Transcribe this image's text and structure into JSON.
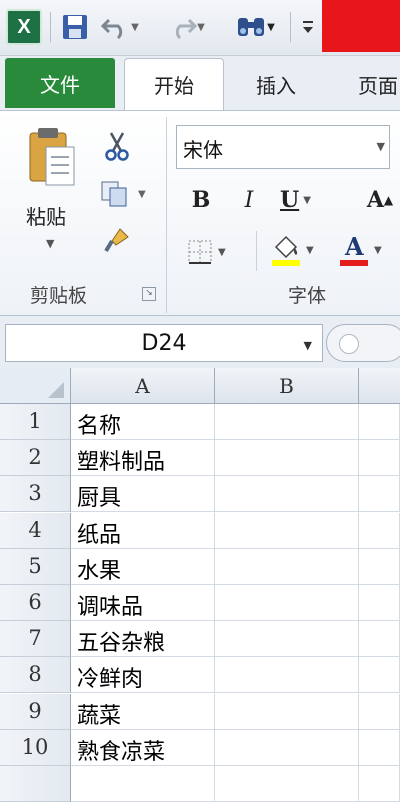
{
  "qat": {
    "app_icon": "X",
    "icons": [
      "save-icon",
      "undo-icon",
      "redo-icon",
      "find-icon",
      "customize-icon"
    ]
  },
  "tabs": {
    "file": "文件",
    "items": [
      "开始",
      "插入",
      "页面"
    ],
    "active": "开始"
  },
  "ribbon": {
    "clipboard": {
      "paste_label": "粘贴",
      "group_label": "剪贴板"
    },
    "font": {
      "font_name": "宋体",
      "bold": "B",
      "italic": "I",
      "underline": "U",
      "group_label": "字体",
      "fill_color": "#ffff00",
      "font_color": "#e31c1c"
    }
  },
  "namebox": {
    "value": "D24"
  },
  "grid": {
    "columns": [
      "A",
      "B"
    ],
    "rows": [
      {
        "num": "1",
        "a": "名称"
      },
      {
        "num": "2",
        "a": "塑料制品"
      },
      {
        "num": "3",
        "a": "厨具"
      },
      {
        "num": "4",
        "a": "纸品"
      },
      {
        "num": "5",
        "a": "水果"
      },
      {
        "num": "6",
        "a": "调味品"
      },
      {
        "num": "7",
        "a": "五谷杂粮"
      },
      {
        "num": "8",
        "a": "冷鲜肉"
      },
      {
        "num": "9",
        "a": "蔬菜"
      },
      {
        "num": "10",
        "a": "熟食凉菜"
      }
    ]
  }
}
